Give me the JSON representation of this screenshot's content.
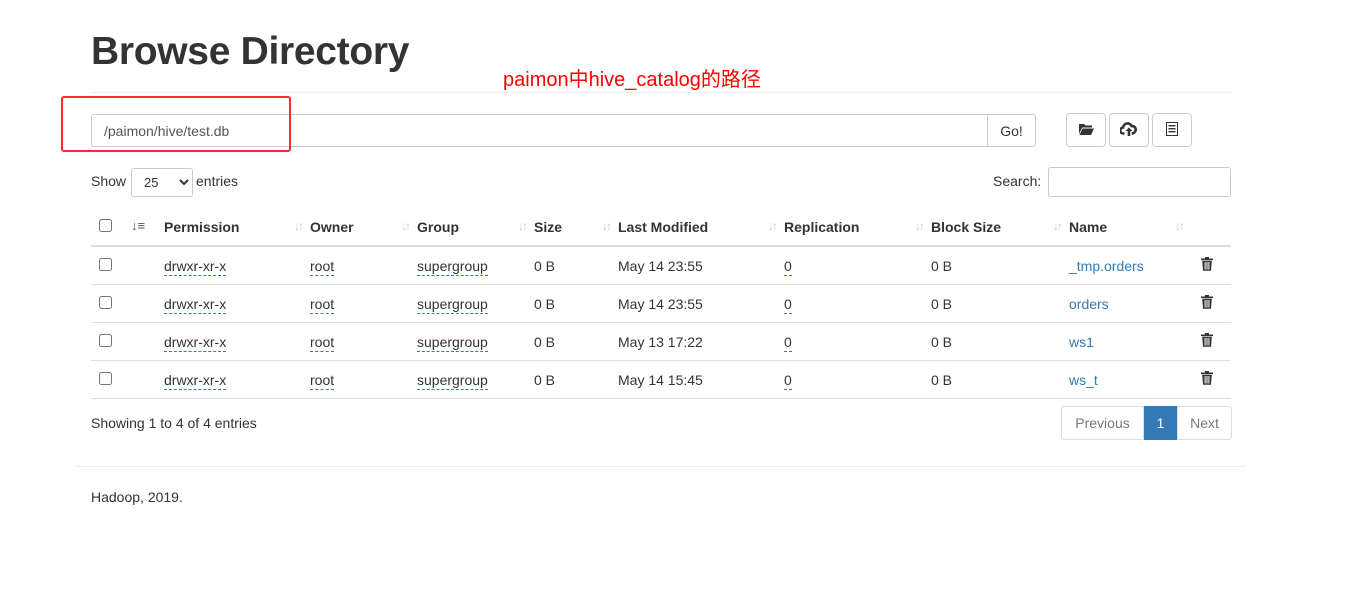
{
  "page": {
    "title": "Browse Directory"
  },
  "annotation": {
    "text": "paimon中hive_catalog的路径",
    "color": "#ff0000"
  },
  "path_bar": {
    "value": "/paimon/hive/test.db",
    "go_label": "Go!"
  },
  "toolbar": {
    "icons": [
      "folder-open-icon",
      "cloud-upload-icon",
      "list-icon"
    ]
  },
  "controls": {
    "show_label": "Show",
    "entries_value": "25",
    "entries_options": [
      "25"
    ],
    "entries_label": "entries",
    "search_label": "Search:",
    "search_value": ""
  },
  "table": {
    "columns": [
      "Permission",
      "Owner",
      "Group",
      "Size",
      "Last Modified",
      "Replication",
      "Block Size",
      "Name"
    ],
    "rows": [
      {
        "permission": "drwxr-xr-x",
        "owner": "root",
        "group": "supergroup",
        "size": "0 B",
        "modified": "May 14 23:55",
        "replication": "0",
        "block_size": "0 B",
        "name": "_tmp.orders"
      },
      {
        "permission": "drwxr-xr-x",
        "owner": "root",
        "group": "supergroup",
        "size": "0 B",
        "modified": "May 14 23:55",
        "replication": "0",
        "block_size": "0 B",
        "name": "orders"
      },
      {
        "permission": "drwxr-xr-x",
        "owner": "root",
        "group": "supergroup",
        "size": "0 B",
        "modified": "May 13 17:22",
        "replication": "0",
        "block_size": "0 B",
        "name": "ws1"
      },
      {
        "permission": "drwxr-xr-x",
        "owner": "root",
        "group": "supergroup",
        "size": "0 B",
        "modified": "May 14 15:45",
        "replication": "0",
        "block_size": "0 B",
        "name": "ws_t"
      }
    ]
  },
  "pagination": {
    "info": "Showing 1 to 4 of 4 entries",
    "previous": "Previous",
    "current": "1",
    "next": "Next"
  },
  "footer": {
    "text": "Hadoop, 2019."
  },
  "colors": {
    "link": "#337ab7",
    "highlight": "#ff2a2a"
  }
}
